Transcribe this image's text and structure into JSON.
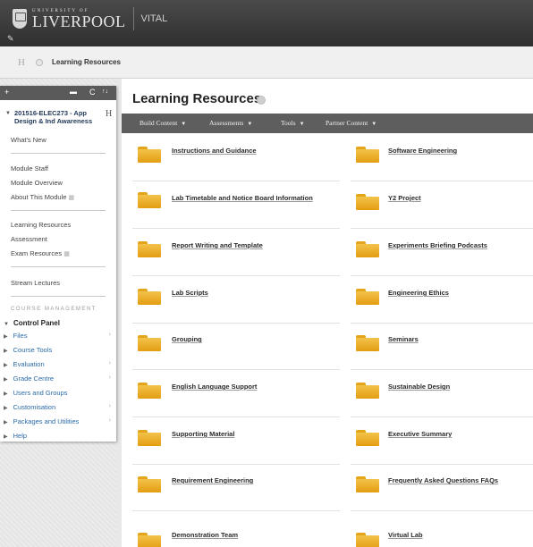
{
  "header": {
    "university_small": "UNIVERSITY OF",
    "university_big": "LIVERPOOL",
    "app_name": "VITAL"
  },
  "breadcrumb": {
    "home_label": "H",
    "current": "Learning Resources"
  },
  "sidebar": {
    "toolbar": {
      "add": "+",
      "folder": "▬",
      "refresh": "C",
      "sort": "↑↓"
    },
    "course_title": "201516-ELEC273 - App Design & Ind Awareness",
    "course_home_char": "H",
    "groups": [
      [
        "What's New"
      ],
      [
        "Module Staff",
        "Module Overview",
        "About This Module"
      ],
      [
        "Learning Resources",
        "Assessment",
        "Exam Resources"
      ],
      [
        "Stream Lectures"
      ]
    ],
    "course_management_label": "COURSE MANAGEMENT",
    "control_panel_label": "Control Panel",
    "tools": [
      "Files",
      "Course Tools",
      "Evaluation",
      "Grade Centre",
      "Users and Groups",
      "Customisation",
      "Packages and Utilities",
      "Help"
    ]
  },
  "main": {
    "title": "Learning Resources",
    "actions": [
      "Build Content",
      "Assessments",
      "Tools",
      "Partner Content"
    ],
    "items_left": [
      "Instructions and Guidance",
      "Lab Timetable and Notice Board Information",
      "Report Writing and Template",
      "Lab Scripts",
      "Grouping",
      "English Language Support",
      "Supporting Material",
      "Requirement Engineering",
      "Demonstration Team"
    ],
    "items_right": [
      "Software Engineering",
      "Y2 Project",
      "Experiments Briefing Podcasts",
      "Engineering Ethics",
      "Seminars",
      "Sustainable Design",
      "Executive Summary",
      "Frequently Asked Questions FAQs",
      "Virtual Lab"
    ]
  },
  "colors": {
    "brand_bar": "#3a3a3a",
    "action_bar": "#5e5e5e",
    "folder": "#eeb12e",
    "tool_link": "#2a6aa8"
  }
}
